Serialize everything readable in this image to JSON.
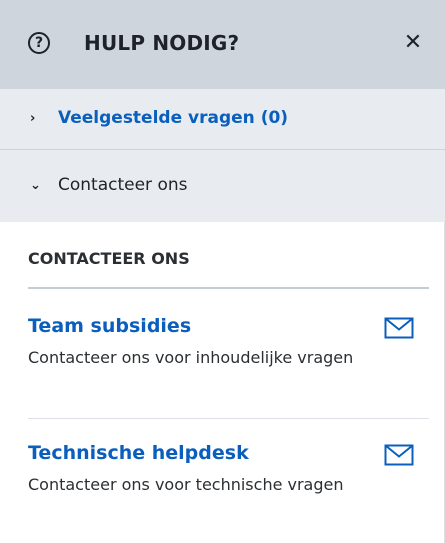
{
  "header": {
    "icon": "question-circle-icon",
    "icon_glyph": "?",
    "title": "HULP NODIG?",
    "close_glyph": "✕",
    "background": "#cfd5dd"
  },
  "accordion": {
    "faq": {
      "chevron": "›",
      "label": "Veelgestelde vragen (0)",
      "expanded": false,
      "color": "#0a5fbd"
    },
    "contact": {
      "chevron": "⌄",
      "label": "Contacteer ons",
      "expanded": true
    }
  },
  "section": {
    "heading": "CONTACTEER ONS"
  },
  "contacts": [
    {
      "title": "Team subsidies",
      "description": "Contacteer ons voor inhoudelijke vragen",
      "icon": "mail-icon"
    },
    {
      "title": "Technische helpdesk",
      "description": "Contacteer ons voor technische vragen",
      "icon": "mail-icon"
    }
  ],
  "colors": {
    "link": "#0a5fbd",
    "text": "#2b2f33",
    "row_background": "#e8ecf0"
  }
}
